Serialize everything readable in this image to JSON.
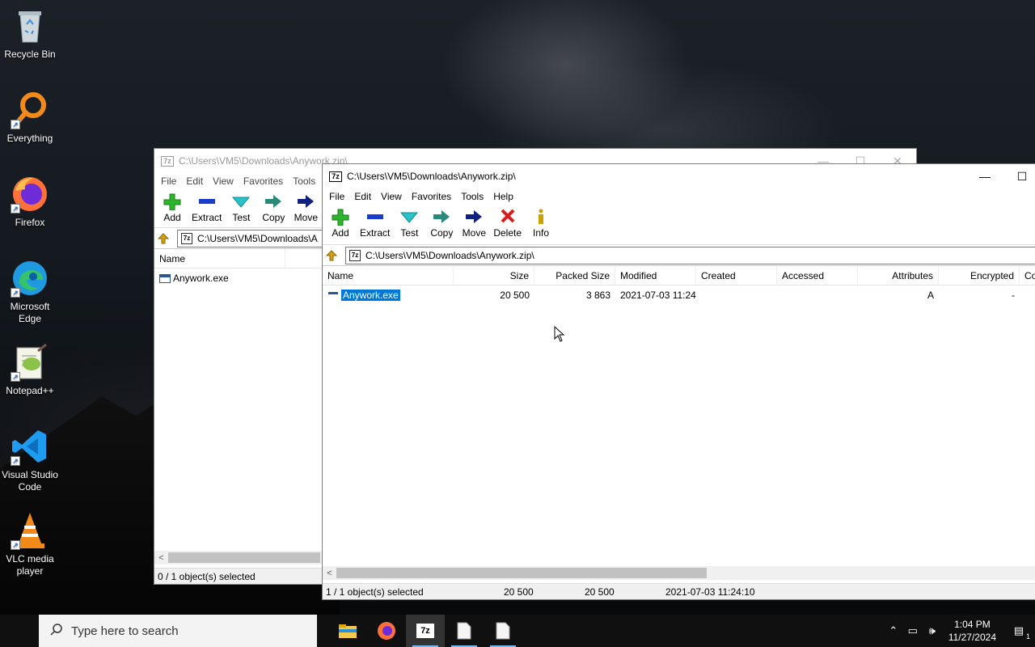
{
  "desktop": {
    "icons": [
      {
        "label": "Recycle Bin"
      },
      {
        "label": "Everything"
      },
      {
        "label": "Firefox"
      },
      {
        "label": "Microsoft Edge"
      },
      {
        "label": "Notepad++"
      },
      {
        "label": "Visual Studio Code"
      },
      {
        "label": "VLC media player"
      }
    ]
  },
  "back_window": {
    "title": "C:\\Users\\VM5\\Downloads\\Anywork.zip\\",
    "menu": [
      "File",
      "Edit",
      "View",
      "Favorites",
      "Tools"
    ],
    "toolbar": [
      "Add",
      "Extract",
      "Test",
      "Copy",
      "Move"
    ],
    "address": "C:\\Users\\VM5\\Downloads\\A",
    "column_name": "Name",
    "file_name": "Anywork.exe",
    "status": "0 / 1 object(s) selected"
  },
  "front_window": {
    "title": "C:\\Users\\VM5\\Downloads\\Anywork.zip\\",
    "menu": [
      "File",
      "Edit",
      "View",
      "Favorites",
      "Tools",
      "Help"
    ],
    "toolbar": [
      "Add",
      "Extract",
      "Test",
      "Copy",
      "Move",
      "Delete",
      "Info"
    ],
    "address": "C:\\Users\\VM5\\Downloads\\Anywork.zip\\",
    "columns": [
      "Name",
      "Size",
      "Packed Size",
      "Modified",
      "Created",
      "Accessed",
      "Attributes",
      "Encrypted",
      "Co"
    ],
    "rows": [
      {
        "name": "Anywork.exe",
        "size": "20 500",
        "packed": "3 863",
        "modified": "2021-07-03 11:24",
        "created": "",
        "accessed": "",
        "attributes": "A",
        "encrypted": "-"
      }
    ],
    "status": {
      "selected": "1 / 1 object(s) selected",
      "size": "20 500",
      "packed": "20 500",
      "modified": "2021-07-03 11:24:10"
    }
  },
  "taskbar": {
    "search_placeholder": "Type here to search",
    "time": "1:04 PM",
    "date": "11/27/2024",
    "notification_count": "1"
  }
}
